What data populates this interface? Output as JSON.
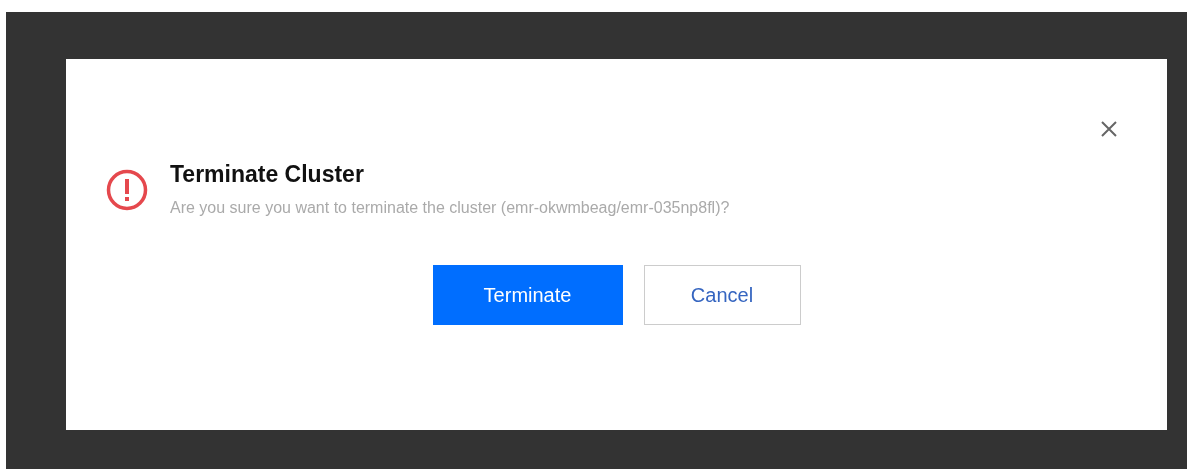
{
  "dialog": {
    "title": "Terminate Cluster",
    "message": "Are you sure you want to terminate the cluster (emr-okwmbeag/emr-035np8fl)?",
    "buttons": [
      {
        "label": "Terminate",
        "kind": "primary"
      },
      {
        "label": "Cancel",
        "kind": "secondary"
      }
    ]
  }
}
